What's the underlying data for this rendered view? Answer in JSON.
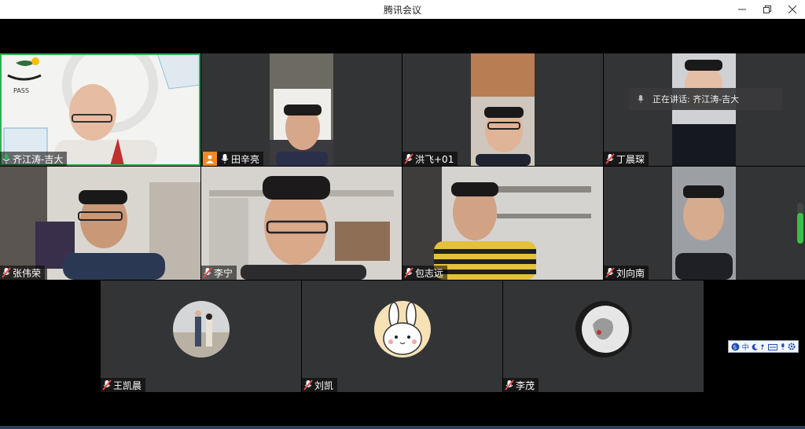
{
  "window": {
    "title": "腾讯会议",
    "controls": [
      "minimize-icon",
      "restore-icon",
      "close-icon"
    ]
  },
  "speaking_indicator": {
    "text": "正在讲话: 齐江涛-吉大"
  },
  "participants": [
    {
      "name": "齐江涛-吉大",
      "mic": "on",
      "active_speaker": true
    },
    {
      "name": "田辛亮",
      "mic": "on",
      "host_badge": true
    },
    {
      "name": "洪飞+01",
      "mic": "muted"
    },
    {
      "name": "丁晨琛",
      "mic": "muted"
    },
    {
      "name": "张伟荣",
      "mic": "muted"
    },
    {
      "name": "李宁",
      "mic": "muted"
    },
    {
      "name": "包志远",
      "mic": "muted"
    },
    {
      "name": "刘向南",
      "mic": "muted"
    },
    {
      "name": "王凯晨",
      "mic": "muted",
      "video": "off"
    },
    {
      "name": "刘凯",
      "mic": "muted",
      "video": "off"
    },
    {
      "name": "李茂",
      "mic": "muted",
      "video": "off"
    }
  ],
  "ime_toolbar": {
    "label": "中",
    "icons": [
      "ime-logo-icon",
      "moon-icon",
      "punctuation-icon",
      "keyboard-icon",
      "mic-icon",
      "gear-icon"
    ]
  },
  "volume": {
    "level": 0.75
  },
  "colors": {
    "active": "#2fb155",
    "muted": "#e04b4b",
    "host": "#f08a24"
  }
}
